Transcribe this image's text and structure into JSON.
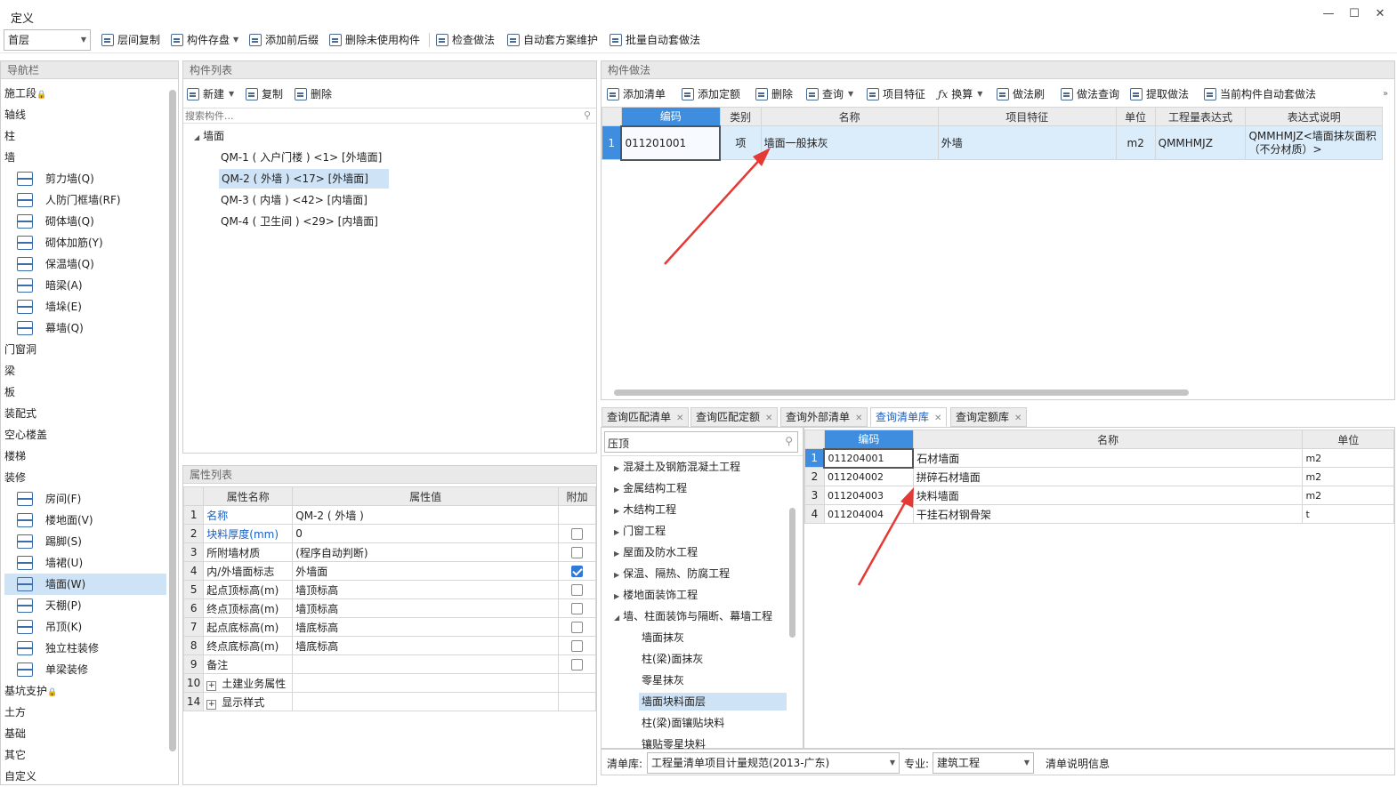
{
  "window": {
    "title": "定义",
    "minimize": "—",
    "maximize": "☐",
    "close": "✕"
  },
  "toolbar": {
    "floor": "首层",
    "buttons": [
      "层间复制",
      "构件存盘",
      "添加前后缀",
      "删除未使用构件",
      "检查做法",
      "自动套方案维护",
      "批量自动套做法"
    ]
  },
  "nav": {
    "title": "导航栏",
    "items": [
      "施工段",
      "轴线",
      "柱",
      "墙"
    ],
    "wall_sub": [
      "剪力墙(Q)",
      "人防门框墙(RF)",
      "砌体墙(Q)",
      "砌体加筋(Y)",
      "保温墙(Q)",
      "暗梁(A)",
      "墙垛(E)",
      "幕墙(Q)"
    ],
    "items2": [
      "门窗洞",
      "梁",
      "板",
      "装配式",
      "空心楼盖",
      "楼梯",
      "装修"
    ],
    "deco_sub": [
      "房间(F)",
      "楼地面(V)",
      "踢脚(S)",
      "墙裙(U)",
      "墙面(W)",
      "天棚(P)",
      "吊顶(K)",
      "独立柱装修",
      "单梁装修"
    ],
    "items3": [
      "基坑支护",
      "土方",
      "基础",
      "其它",
      "自定义"
    ]
  },
  "complist": {
    "title": "构件列表",
    "new": "新建",
    "copy": "复制",
    "delete": "删除",
    "search_placeholder": "搜索构件...",
    "root": "墙面",
    "items": [
      "QM-1 ( 入户门楼 ) <1> [外墙面]",
      "QM-2 ( 外墙 ) <17> [外墙面]",
      "QM-3 ( 内墙 ) <42> [内墙面]",
      "QM-4 ( 卫生间 ) <29> [内墙面]"
    ]
  },
  "props": {
    "title": "属性列表",
    "headers": [
      "属性名称",
      "属性值",
      "附加"
    ],
    "rows": [
      {
        "n": "1",
        "name": "名称",
        "value": "QM-2 ( 外墙 )",
        "blue": true,
        "chk": ""
      },
      {
        "n": "2",
        "name": "块料厚度(mm)",
        "value": "0",
        "blue": true,
        "chk": "off"
      },
      {
        "n": "3",
        "name": "所附墙材质",
        "value": "(程序自动判断)",
        "blue": false,
        "chk": "off"
      },
      {
        "n": "4",
        "name": "内/外墙面标志",
        "value": "外墙面",
        "blue": false,
        "chk": "on"
      },
      {
        "n": "5",
        "name": "起点顶标高(m)",
        "value": "墙顶标高",
        "blue": false,
        "chk": "off"
      },
      {
        "n": "6",
        "name": "终点顶标高(m)",
        "value": "墙顶标高",
        "blue": false,
        "chk": "off"
      },
      {
        "n": "7",
        "name": "起点底标高(m)",
        "value": "墙底标高",
        "blue": false,
        "chk": "off"
      },
      {
        "n": "8",
        "name": "终点底标高(m)",
        "value": "墙底标高",
        "blue": false,
        "chk": "off"
      },
      {
        "n": "9",
        "name": "备注",
        "value": "",
        "blue": false,
        "chk": "off"
      },
      {
        "n": "10",
        "name": "土建业务属性",
        "value": "",
        "blue": false,
        "chk": "",
        "plus": true
      },
      {
        "n": "14",
        "name": "显示样式",
        "value": "",
        "blue": false,
        "chk": "",
        "plus": true
      }
    ]
  },
  "method": {
    "title": "构件做法",
    "buttons": [
      "添加清单",
      "添加定额",
      "删除",
      "查询",
      "项目特征",
      "换算",
      "做法刷",
      "做法查询",
      "提取做法",
      "当前构件自动套做法"
    ],
    "headers": [
      "编码",
      "类别",
      "名称",
      "项目特征",
      "单位",
      "工程量表达式",
      "表达式说明"
    ],
    "row": {
      "n": "1",
      "code": "011201001",
      "type": "项",
      "name": "墙面一般抹灰",
      "feature": "外墙",
      "unit": "m2",
      "expr": "QMMHMJZ",
      "desc": "QMMHMJZ<墙面抹灰面积（不分材质）>"
    }
  },
  "tabs": [
    "查询匹配清单",
    "查询匹配定额",
    "查询外部清单",
    "查询清单库",
    "查询定额库"
  ],
  "lib": {
    "search": "压顶",
    "tree": [
      "混凝土及钢筋混凝土工程",
      "金属结构工程",
      "木结构工程",
      "门窗工程",
      "屋面及防水工程",
      "保温、隔热、防腐工程",
      "楼地面装饰工程",
      "墙、柱面装饰与隔断、幕墙工程"
    ],
    "subtree": [
      "墙面抹灰",
      "柱(梁)面抹灰",
      "零星抹灰",
      "墙面块料面层",
      "柱(梁)面镶贴块料",
      "镶贴零星块料"
    ],
    "headers": [
      "编码",
      "名称",
      "单位"
    ],
    "rows": [
      {
        "n": "1",
        "code": "011204001",
        "name": "石材墙面",
        "unit": "m2"
      },
      {
        "n": "2",
        "code": "011204002",
        "name": "拼碎石材墙面",
        "unit": "m2"
      },
      {
        "n": "3",
        "code": "011204003",
        "name": "块料墙面",
        "unit": "m2"
      },
      {
        "n": "4",
        "code": "011204004",
        "name": "干挂石材钢骨架",
        "unit": "t"
      }
    ],
    "footer": {
      "lib_label": "清单库:",
      "lib_value": "工程量清单项目计量规范(2013-广东)",
      "major_label": "专业:",
      "major_value": "建筑工程",
      "info": "清单说明信息"
    }
  }
}
